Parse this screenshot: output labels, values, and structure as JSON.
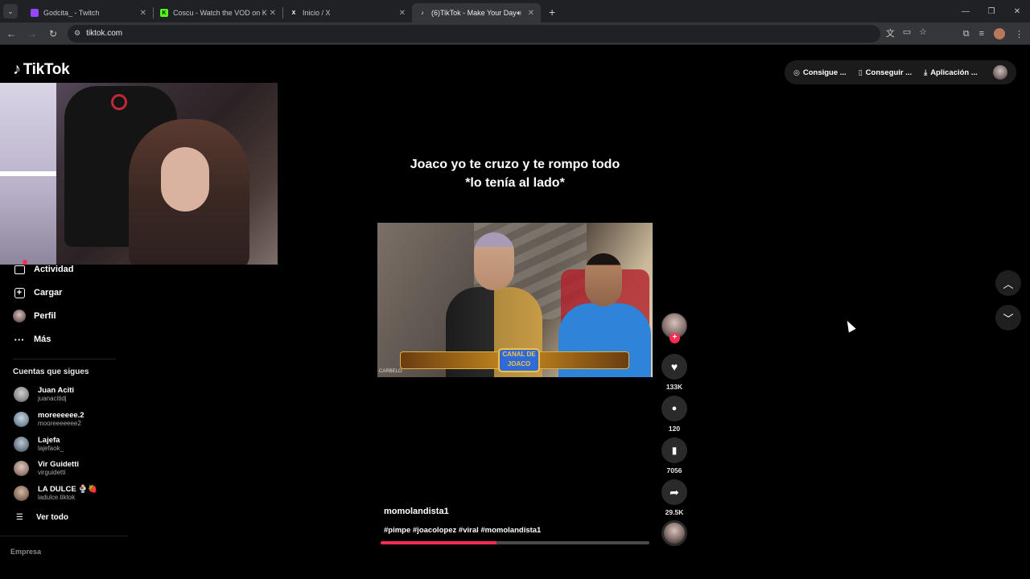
{
  "browser": {
    "tabs": [
      {
        "title": "Godcita_ - Twitch",
        "fav_color": "#9146ff",
        "fav_glyph": "",
        "active": false
      },
      {
        "title": "Coscu - Watch the VOD on Kick",
        "fav_color": "#53fc18",
        "fav_glyph": "K",
        "active": false
      },
      {
        "title": "Inicio / X",
        "fav_color": "#000000",
        "fav_glyph": "X",
        "active": false
      },
      {
        "title": "(6)TikTok - Make Your Day",
        "fav_color": "#000000",
        "fav_glyph": "♪",
        "active": true
      }
    ],
    "address": "tiktok.com"
  },
  "tiktok": {
    "logo_text": "TikTok",
    "top_actions": [
      {
        "label": "Consigue ...",
        "icon": "coin-icon"
      },
      {
        "label": "Conseguir ...",
        "icon": "phone-icon"
      },
      {
        "label": "Aplicación ...",
        "icon": "download-icon"
      }
    ],
    "nav": [
      {
        "label": "Actividad",
        "icon": "activity-icon"
      },
      {
        "label": "Cargar",
        "icon": "upload-icon"
      },
      {
        "label": "Perfil",
        "icon": "profile-icon"
      },
      {
        "label": "Más",
        "icon": "more-icon"
      }
    ],
    "following_title": "Cuentas que sigues",
    "following": [
      {
        "name": "Juan Aciti",
        "username": "juanacitidj",
        "avatar_color": "#8d8d8d"
      },
      {
        "name": "moreeeeee.2",
        "username": "mooreeeeeee2",
        "avatar_color": "#7c8ea0"
      },
      {
        "name": "Lajefa",
        "username": "lajefaok_",
        "avatar_color": "#6d7a8a"
      },
      {
        "name": "Vir Guidetti",
        "username": "virguidetti",
        "avatar_color": "#9a7f75"
      },
      {
        "name": "LA DULCE 🍨🍓",
        "username": "ladulce.tiktok",
        "avatar_color": "#8a7060"
      }
    ],
    "see_all": "Ver todo",
    "footer_heading": "Empresa",
    "video": {
      "caption_line1": "Joaco yo te cruzo y te rompo todo",
      "caption_line2": "*lo tenía al lado*",
      "banner_text": "CANAL DE JOACO",
      "corner_text": "CARBELO",
      "author": "momolandista1",
      "tags": "#pimpe #joacolopez #viral #momolandista1",
      "progress": 0.43
    },
    "actions": {
      "likes": "133K",
      "comments": "120",
      "saves": "7056",
      "shares": "29.5K"
    }
  }
}
